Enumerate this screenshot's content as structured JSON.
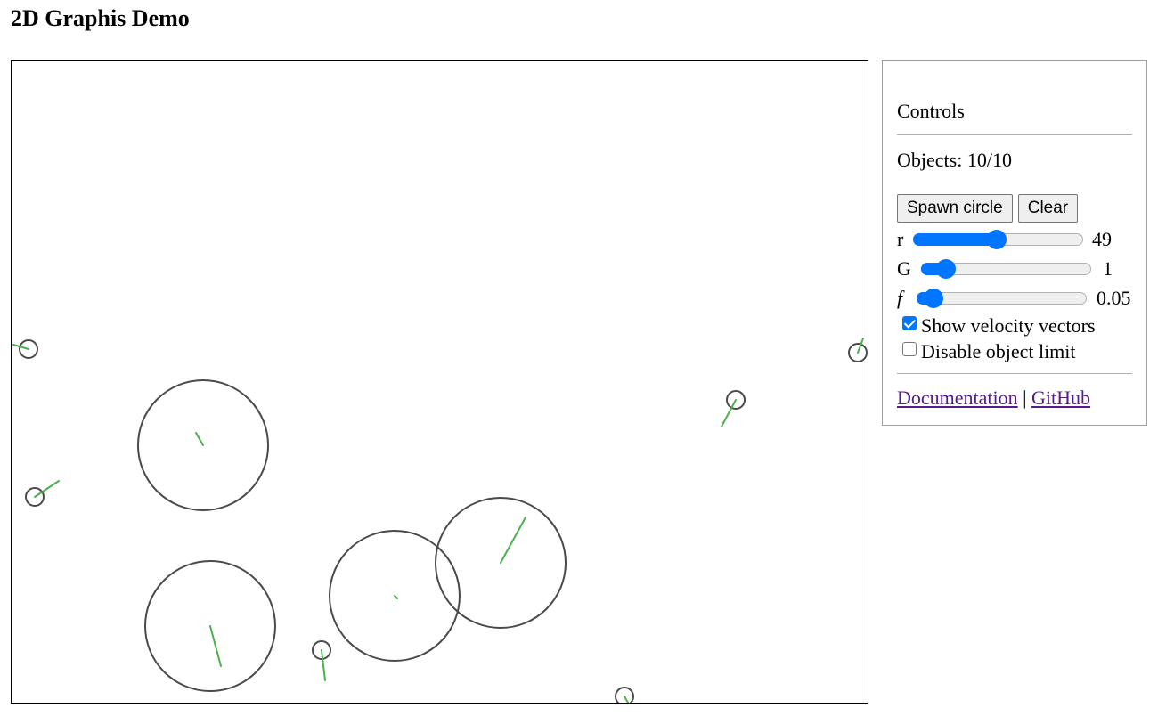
{
  "page": {
    "title": "2D Graphis Demo"
  },
  "controls": {
    "title": "Controls",
    "objects_label": "Objects:",
    "objects_count": "10/10",
    "spawn_label": "Spawn circle",
    "clear_label": "Clear",
    "sliders": [
      {
        "label": "r",
        "value": "49",
        "fraction": 0.49
      },
      {
        "label": "G",
        "value": "1",
        "fraction": 0.1
      },
      {
        "label": "f",
        "value": "0.05",
        "fraction": 0.05
      }
    ],
    "show_velocity_label": "Show velocity vectors",
    "show_velocity_checked": true,
    "disable_limit_label": "Disable object limit",
    "disable_limit_checked": false,
    "documentation_link": "Documentation",
    "link_separator": "|",
    "github_link": "GitHub"
  },
  "colors": {
    "circle_stroke": "#4a4a4a",
    "velocity_vector": "#4caf50",
    "accent": "#0075ff",
    "link": "#551a8b"
  }
}
